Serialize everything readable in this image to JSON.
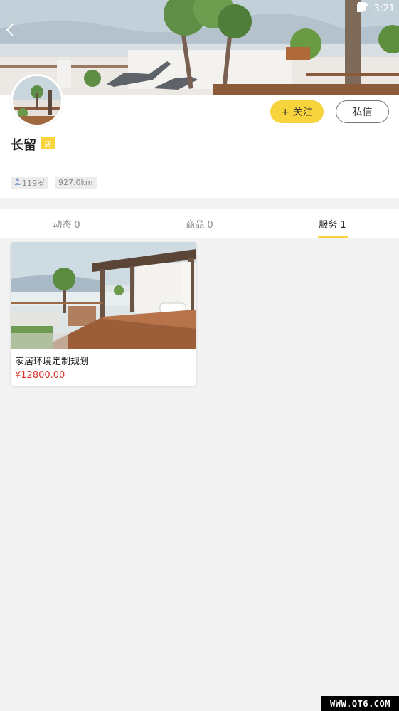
{
  "status_bar": {
    "time": "3:21"
  },
  "profile": {
    "name": "长留",
    "shop_badge": "店",
    "follow_label": "+ 关注",
    "message_label": "私信",
    "age_tag": "119岁",
    "distance_tag": "927.0km"
  },
  "tabs": [
    {
      "label": "动态 0",
      "active": false
    },
    {
      "label": "商品 0",
      "active": false
    },
    {
      "label": "服务 1",
      "active": true
    }
  ],
  "services": [
    {
      "title": "家居环境定制规划",
      "price": "¥12800.00"
    }
  ],
  "watermark": "WWW.QT6.COM",
  "colors": {
    "accent": "#f8d43c",
    "price": "#d9372b",
    "background": "#f3f3f3"
  }
}
